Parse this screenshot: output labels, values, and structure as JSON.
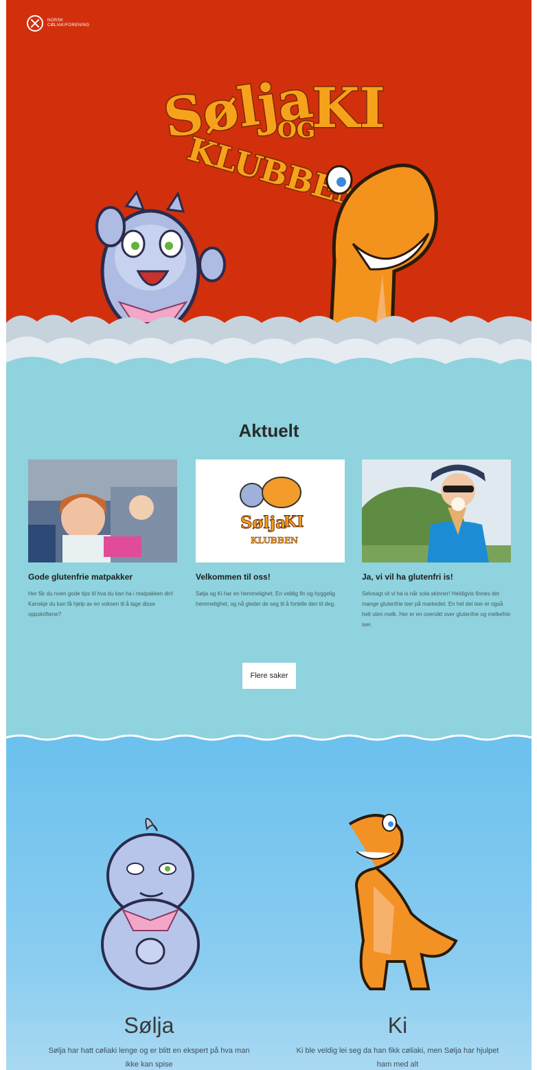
{
  "header": {
    "logo_icon": "cross-circle-icon",
    "logo_line1": "NORSK",
    "logo_line2": "CØLIAKIFORENING"
  },
  "hero": {
    "title_word1": "Sølja",
    "title_og": "OG",
    "title_word2": "KI",
    "title_word3": "KLUBBEN",
    "background": "#d2300c"
  },
  "news": {
    "heading": "Aktuelt",
    "cards": [
      {
        "title": "Gode glutenfrie matpakker",
        "text": "Her får du noen gode tips til hva du kan ha i matpakken din! Kanskje du kan få hjelp av en voksen til å lage disse oppskriftene?"
      },
      {
        "title": "Velkommen til oss!",
        "text": "Sølja og Ki har en hemmelighet. En veldig fin og hyggelig hemmelighet, og nå gleder de seg til å fortelle den til deg."
      },
      {
        "title": "Ja, vi vil ha glutenfri is!",
        "text": "Selvsagt vil vi ha is når sola skinner! Heldigvis finnes det mange glutenfrie iser på markedet. En hel del iser er også helt uten melk. Her er en oversikt over glutenfrie og melkefrie iser."
      }
    ],
    "more_button": "Flere saker",
    "background": "#8ed3de"
  },
  "characters": {
    "left": {
      "name": "Sølja",
      "text": "Sølja har hatt cøliaki lenge og er blitt en ekspert på hva man ikke kan spise"
    },
    "right": {
      "name": "Ki",
      "text": "Ki ble veldig lei seg da han fikk cøliaki, men Sølja har hjulpet ham med alt"
    }
  }
}
